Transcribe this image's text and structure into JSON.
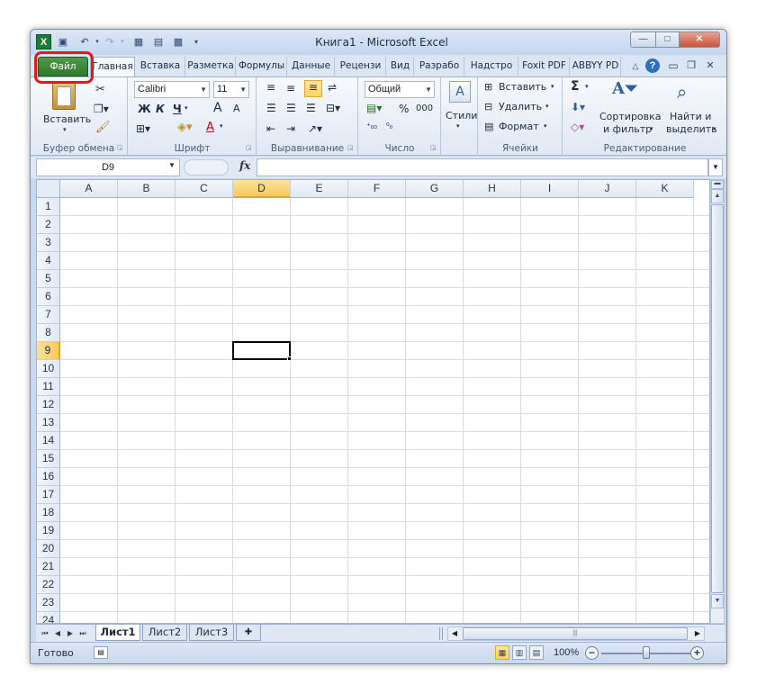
{
  "window": {
    "title": "Книга1 - Microsoft Excel",
    "logo": "X",
    "controls": {
      "minimize": "—",
      "maximize": "□",
      "close": "✕"
    }
  },
  "qat": [
    {
      "name": "save-icon",
      "glyph": "💾"
    },
    {
      "name": "undo-icon",
      "glyph": "↶"
    },
    {
      "name": "redo-icon",
      "glyph": "↷"
    },
    {
      "name": "form-icon",
      "glyph": "▦"
    },
    {
      "name": "form2-icon",
      "glyph": "▤"
    },
    {
      "name": "calculator-icon",
      "glyph": "▩"
    },
    {
      "name": "customize-qat-icon",
      "glyph": "▾"
    }
  ],
  "tabs": {
    "file": "Файл",
    "items": [
      "Главная",
      "Вставка",
      "Разметка",
      "Формулы",
      "Данные",
      "Рецензи",
      "Вид",
      "Разрабо",
      "Надстро",
      "Foxit PDF",
      "ABBYY PD"
    ],
    "active_index": 0
  },
  "ribbon": {
    "clipboard": {
      "label": "Буфер обмена",
      "paste": "Вставить",
      "paste_arrow": "▾"
    },
    "font": {
      "label": "Шрифт",
      "font_name": "Calibri",
      "font_size": "11",
      "bold": "Ж",
      "italic": "К",
      "underline": "Ч",
      "grow": "A",
      "shrink": "A",
      "font_color_letter": "A"
    },
    "alignment": {
      "label": "Выравнивание"
    },
    "number": {
      "label": "Число",
      "format": "Общий",
      "percent": "%",
      "thousands": "000"
    },
    "styles": {
      "label": "Стили"
    },
    "cells": {
      "label": "Ячейки",
      "insert": "Вставить",
      "delete": "Удалить",
      "format": "Формат"
    },
    "editing": {
      "label": "Редактирование",
      "sigma": "Σ",
      "sort_line1": "Сортировка",
      "sort_line2": "и фильтр",
      "find_line1": "Найти и",
      "find_line2": "выделить"
    }
  },
  "formula_bar": {
    "name_box": "D9",
    "fx": "fx",
    "formula": ""
  },
  "grid": {
    "columns": [
      "A",
      "B",
      "C",
      "D",
      "E",
      "F",
      "G",
      "H",
      "I",
      "J",
      "K"
    ],
    "rows": [
      "1",
      "2",
      "3",
      "4",
      "5",
      "6",
      "7",
      "8",
      "9",
      "10",
      "11",
      "12",
      "13",
      "14",
      "15",
      "16",
      "17",
      "18",
      "19",
      "20",
      "21",
      "22",
      "23",
      "24"
    ],
    "active_cell": {
      "column": "D",
      "row": "9"
    }
  },
  "sheets": {
    "tabs": [
      "Лист1",
      "Лист2",
      "Лист3"
    ],
    "active": "Лист1",
    "nav": [
      "⏮",
      "◀",
      "▶",
      "⏭"
    ]
  },
  "status": {
    "text": "Готово",
    "zoom": "100%",
    "zoom_level_percent": 100
  },
  "colors": {
    "file_tab": "#2f7a2b",
    "highlight_ring": "#e31a1a",
    "active_header": "#f8c95a"
  }
}
